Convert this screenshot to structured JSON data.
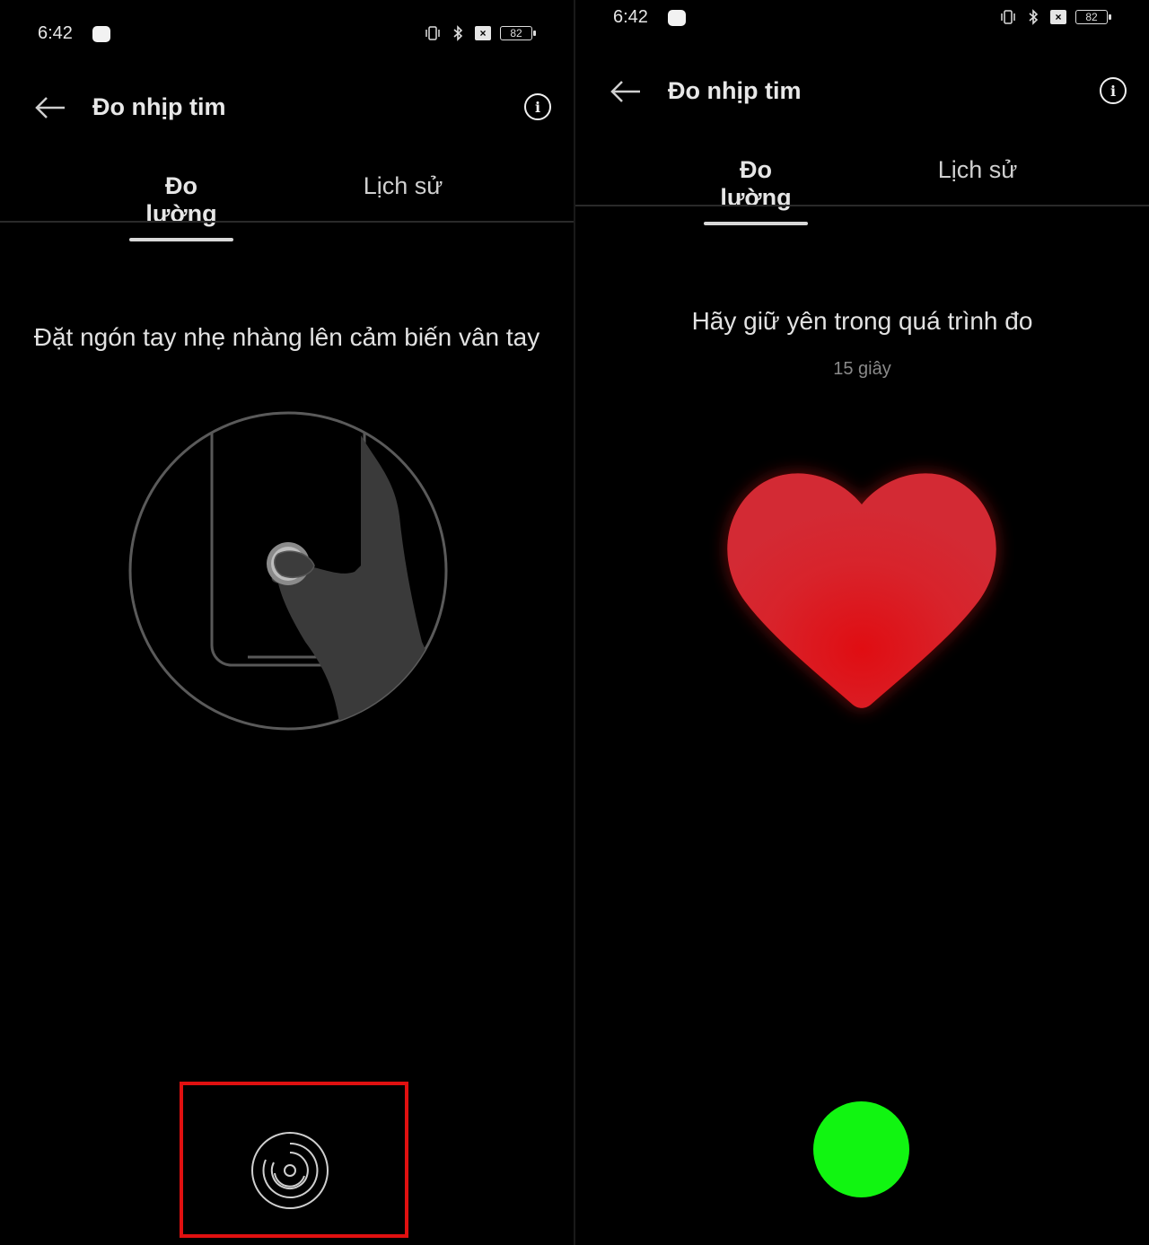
{
  "left": {
    "status": {
      "time": "6:42",
      "battery": "82"
    },
    "header": {
      "title": "Đo nhịp tim"
    },
    "tabs": [
      {
        "label": "Đo lường"
      },
      {
        "label": "Lịch sử"
      }
    ],
    "instruction": "Đặt ngón tay nhẹ nhàng lên cảm biến vân tay"
  },
  "right": {
    "status": {
      "time": "6:42",
      "battery": "82"
    },
    "header": {
      "title": "Đo nhịp tim"
    },
    "tabs": [
      {
        "label": "Đo lường"
      },
      {
        "label": "Lịch sử"
      }
    ],
    "instruction": "Hãy giữ yên trong quá trình đo",
    "timer": "15 giây"
  },
  "colors": {
    "background": "#000000",
    "highlight_box": "#e01010",
    "heart": "#e01a22",
    "indicator": "#11f511"
  },
  "icons": [
    "back-arrow-icon",
    "info-icon",
    "vibrate-icon",
    "bluetooth-icon",
    "x-icon",
    "battery-icon",
    "fingerprint-icon",
    "heart-icon"
  ]
}
